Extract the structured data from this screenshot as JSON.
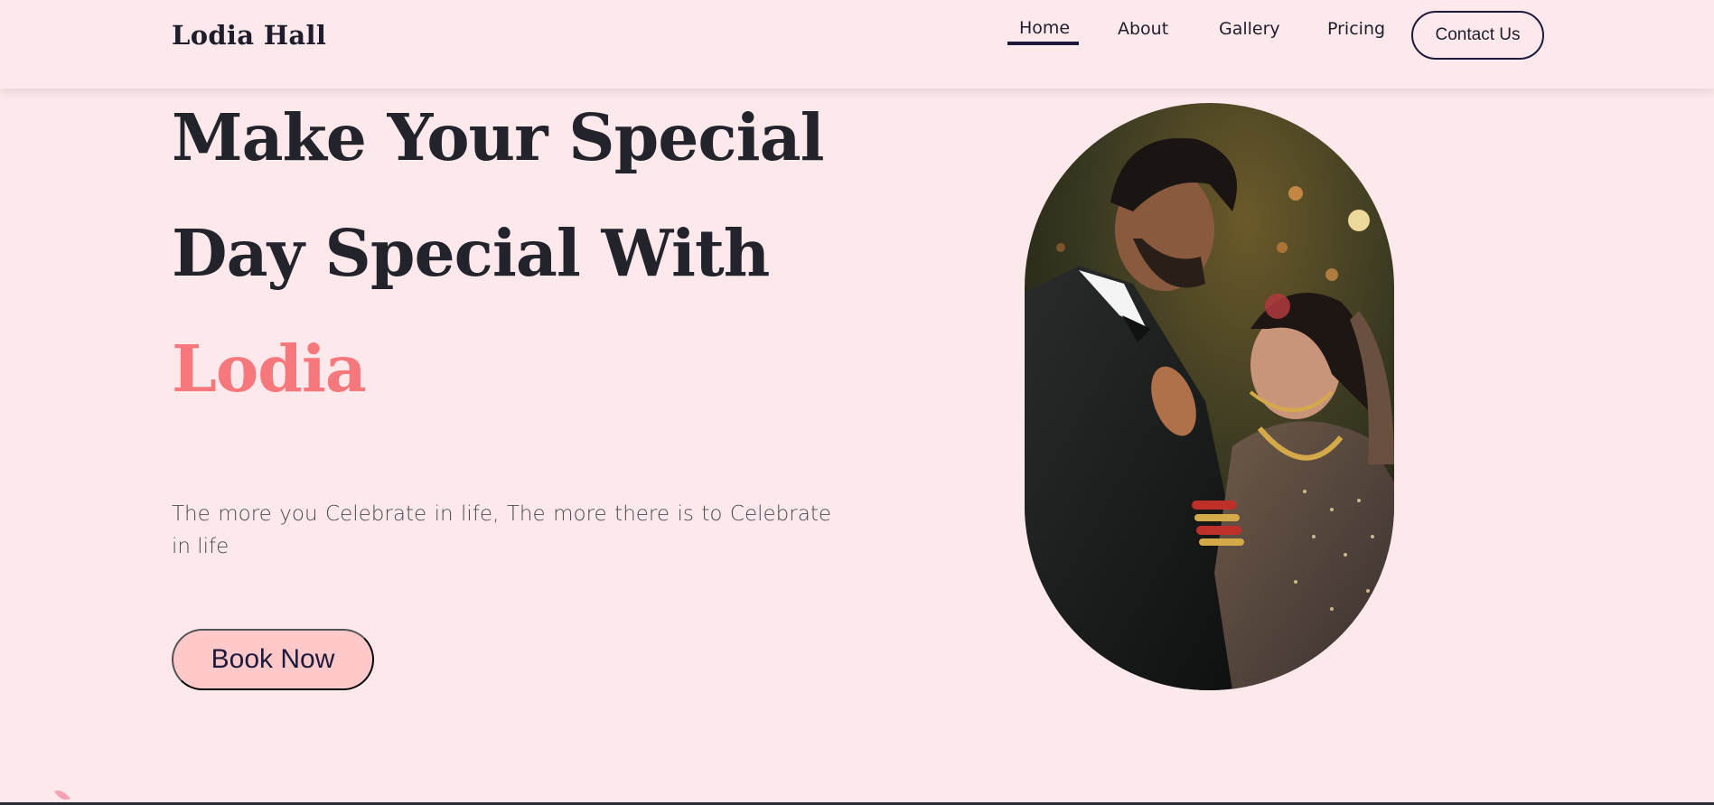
{
  "brand": {
    "name": "Lodia Hall"
  },
  "nav": {
    "items": [
      {
        "label": "Home",
        "active": true
      },
      {
        "label": "About",
        "active": false
      },
      {
        "label": "Gallery",
        "active": false
      },
      {
        "label": "Pricing",
        "active": false
      }
    ],
    "contact_label": "Contact Us"
  },
  "hero": {
    "line1": "Make Your Special",
    "line2": "Day Special With",
    "line3": "Lodia",
    "tagline": "The more you Celebrate in life, The more there is to Celebrate in life",
    "cta_label": "Book Now"
  },
  "colors": {
    "background": "#fde9eb",
    "accent": "#f7787c",
    "button": "#ffc8c9",
    "dark": "#1d1a3b"
  },
  "icons": [
    "couple-photo",
    "petal-icon"
  ]
}
